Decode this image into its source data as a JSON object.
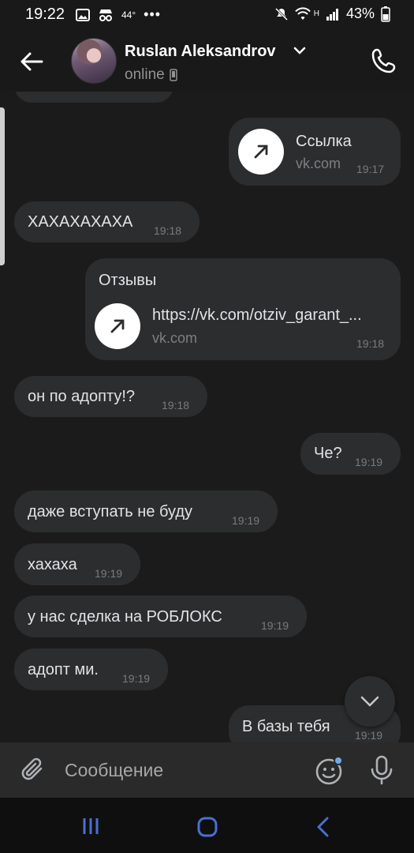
{
  "statusbar": {
    "time": "19:22",
    "temperature": "44°",
    "more": "•••",
    "network_type": "H",
    "battery": "43%"
  },
  "header": {
    "contact_name": "Ruslan Aleksandrov",
    "status": "online"
  },
  "messages": [
    {
      "side": "out",
      "type": "link",
      "title": "Ссылка",
      "domain": "vk.com",
      "time": "19:17"
    },
    {
      "side": "in",
      "type": "text",
      "text": "ХАХАХАХАХА",
      "time": "19:18"
    },
    {
      "side": "out",
      "type": "link_with_text",
      "text": "Отзывы",
      "title": "https://vk.com/otziv_garant_...",
      "domain": "vk.com",
      "time": "19:18"
    },
    {
      "side": "in",
      "type": "text",
      "text": "он по адопту!?",
      "time": "19:18"
    },
    {
      "side": "out",
      "type": "text",
      "text": "Че?",
      "time": "19:19"
    },
    {
      "side": "in",
      "type": "text",
      "text": "даже вступать не буду",
      "time": "19:19"
    },
    {
      "side": "in",
      "type": "text",
      "text": "хахаха",
      "time": "19:19"
    },
    {
      "side": "in",
      "type": "text",
      "text": "у нас сделка на РОБЛОКС",
      "time": "19:19"
    },
    {
      "side": "in",
      "type": "text",
      "text": "адопт ми.",
      "time": "19:19"
    },
    {
      "side": "out",
      "type": "text",
      "text": "В базы тебя",
      "time": "19:19"
    }
  ],
  "composer": {
    "placeholder": "Сообщение"
  },
  "colors": {
    "bubble": "#2c2d2e",
    "background": "#1b1b1b",
    "header": "#191919",
    "text": "#e1e3e6",
    "timestamp": "#7a7b7c",
    "accent_dot": "#71aaeb"
  },
  "icons": [
    "back-arrow-icon",
    "phone-icon",
    "chevron-down-icon",
    "mobile-icon",
    "link-arrow-icon",
    "attach-icon",
    "sticker-icon",
    "mic-icon",
    "recents-icon",
    "home-icon",
    "nav-back-icon"
  ]
}
